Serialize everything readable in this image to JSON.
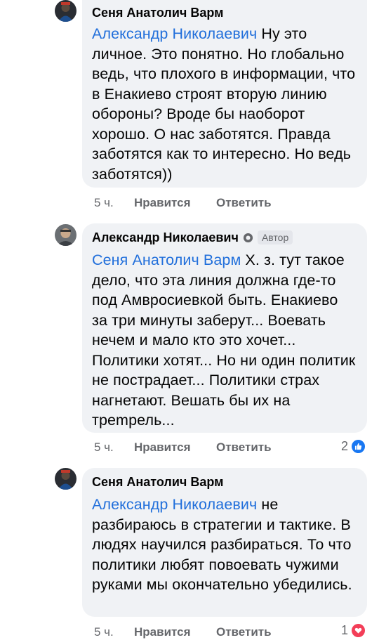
{
  "comments": [
    {
      "author": "Сеня Анатолич Варм",
      "mention": "Александр Николаевич",
      "text": " Ну это личное. Это понятно. Но глобально ведь, что плохого в информации, что в Енакиево строят вторую линию обороны? Вроде бы наоборот хорошо. О нас заботятся. Правда заботятся как то интересно. Но ведь заботятся))",
      "time": "5 ч.",
      "like": "Нравится",
      "reply": "Ответить"
    },
    {
      "author": "Александр Николаевич",
      "badge": "Автор",
      "mention": "Сеня Анатолич Варм",
      "text": " Х. з. тут такое дело, что эта линия должна где-то под Амвросиевкой быть. Енакиево за три минуты заберут... Воевать нечем и мало кто это хочет... Политики хотят... Но ни один политик не пострадает... Политики страх нагнетают. Вешать бы их на трempель...",
      "time": "5 ч.",
      "like": "Нравится",
      "reply": "Ответить",
      "reaction_count": "2",
      "reaction_icon": "like-icon",
      "reaction_color": "#1877f2"
    },
    {
      "author": "Сеня Анатолич Варм",
      "mention": "Александр Николаевич",
      "text": " не разбираюсь в стратегии и тактике. В людях научился разбираться. То что политики любят повоевать чужими руками мы окончательно убедились.",
      "time": "5 ч.",
      "like": "Нравится",
      "reply": "Ответить",
      "reaction_count": "1",
      "reaction_icon": "love-icon",
      "reaction_color": "#f33e58"
    }
  ]
}
